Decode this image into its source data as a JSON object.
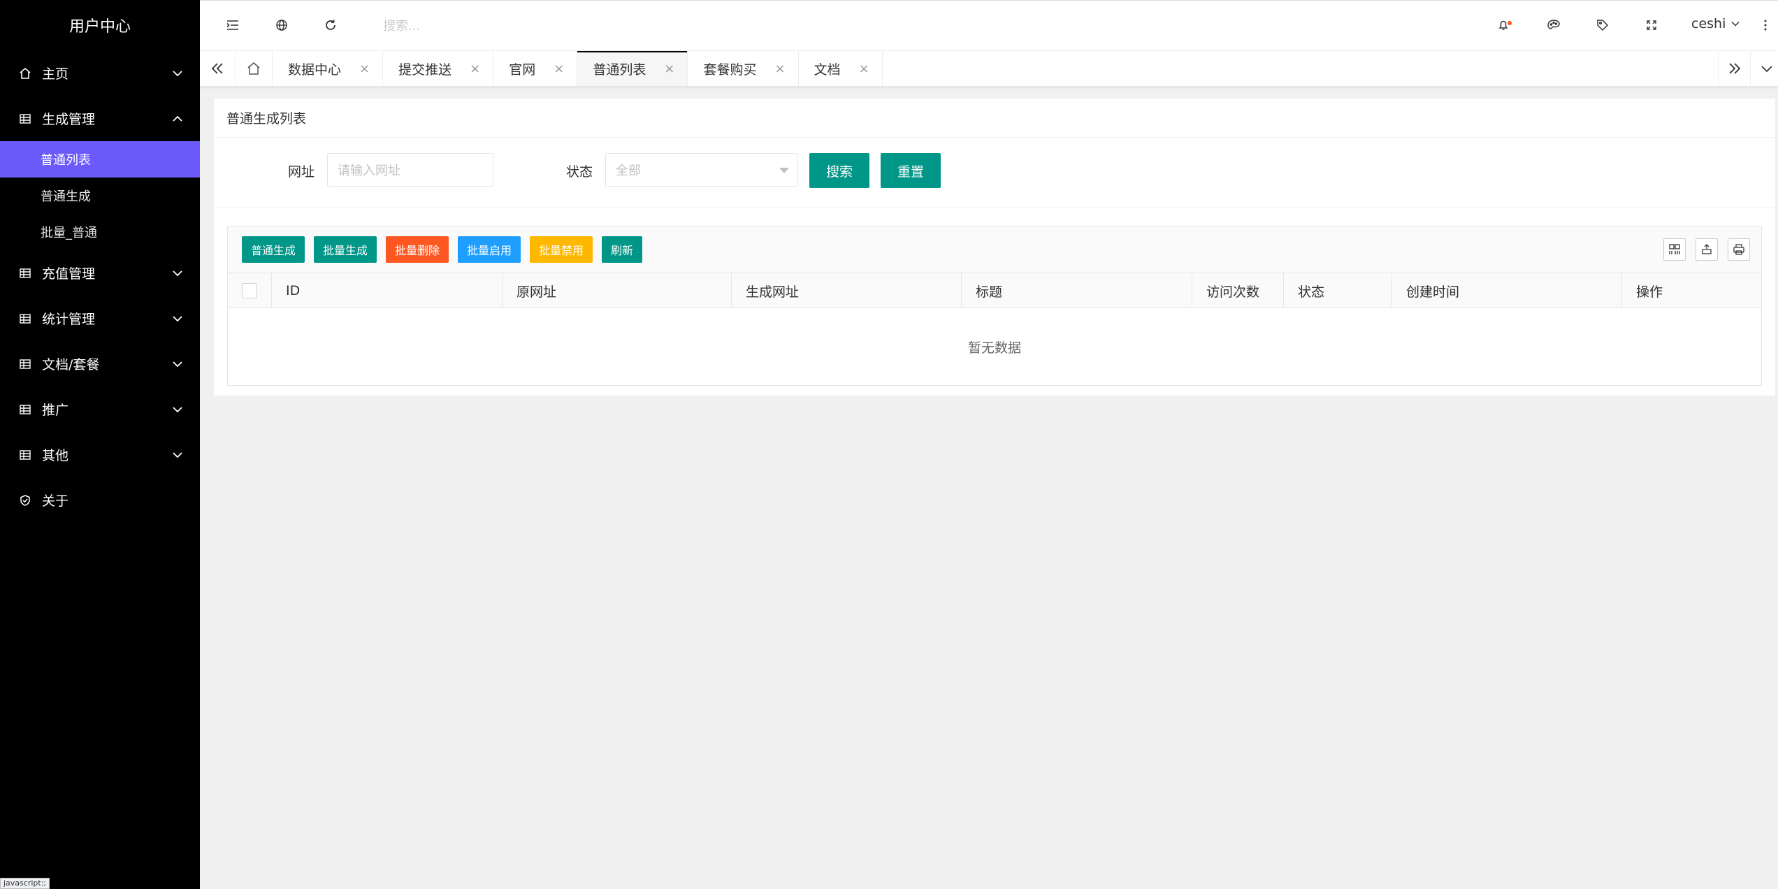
{
  "sidebar": {
    "brand": "用户中心",
    "items": [
      {
        "label": "主页"
      },
      {
        "label": "生成管理",
        "sub": [
          {
            "label": "普通列表"
          },
          {
            "label": "普通生成"
          },
          {
            "label": "批量_普通"
          }
        ]
      },
      {
        "label": "充值管理"
      },
      {
        "label": "统计管理"
      },
      {
        "label": "文档/套餐"
      },
      {
        "label": "推广"
      },
      {
        "label": "其他"
      },
      {
        "label": "关于"
      }
    ]
  },
  "status_tip": "javascript:;",
  "header": {
    "search_placeholder": "搜索...",
    "username": "ceshi",
    "notification_dot_color": "#ff5722"
  },
  "tabs": [
    {
      "label": "数据中心"
    },
    {
      "label": "提交推送"
    },
    {
      "label": "官网"
    },
    {
      "label": "普通列表"
    },
    {
      "label": "套餐购买"
    },
    {
      "label": "文档"
    }
  ],
  "main": {
    "card_title": "普通生成列表",
    "filters": {
      "url_label": "网址",
      "url_placeholder": "请输入网址",
      "status_label": "状态",
      "status_value": "全部",
      "search_button": "搜索",
      "reset_button": "重置"
    },
    "toolbar": [
      {
        "label": "普通生成",
        "color": "#009688"
      },
      {
        "label": "批量生成",
        "color": "#009688"
      },
      {
        "label": "批量删除",
        "color": "#ff5722"
      },
      {
        "label": "批量启用",
        "color": "#1e9fff"
      },
      {
        "label": "批量禁用",
        "color": "#ffb800"
      },
      {
        "label": "刷新",
        "color": "#009688"
      }
    ],
    "columns": [
      "ID",
      "原网址",
      "生成网址",
      "标题",
      "访问次数",
      "状态",
      "创建时间",
      "操作"
    ],
    "empty_text": "暂无数据"
  },
  "colors": {
    "sidebar_bg": "#000000",
    "active_menu": "#6a5af9",
    "primary": "#009688"
  }
}
